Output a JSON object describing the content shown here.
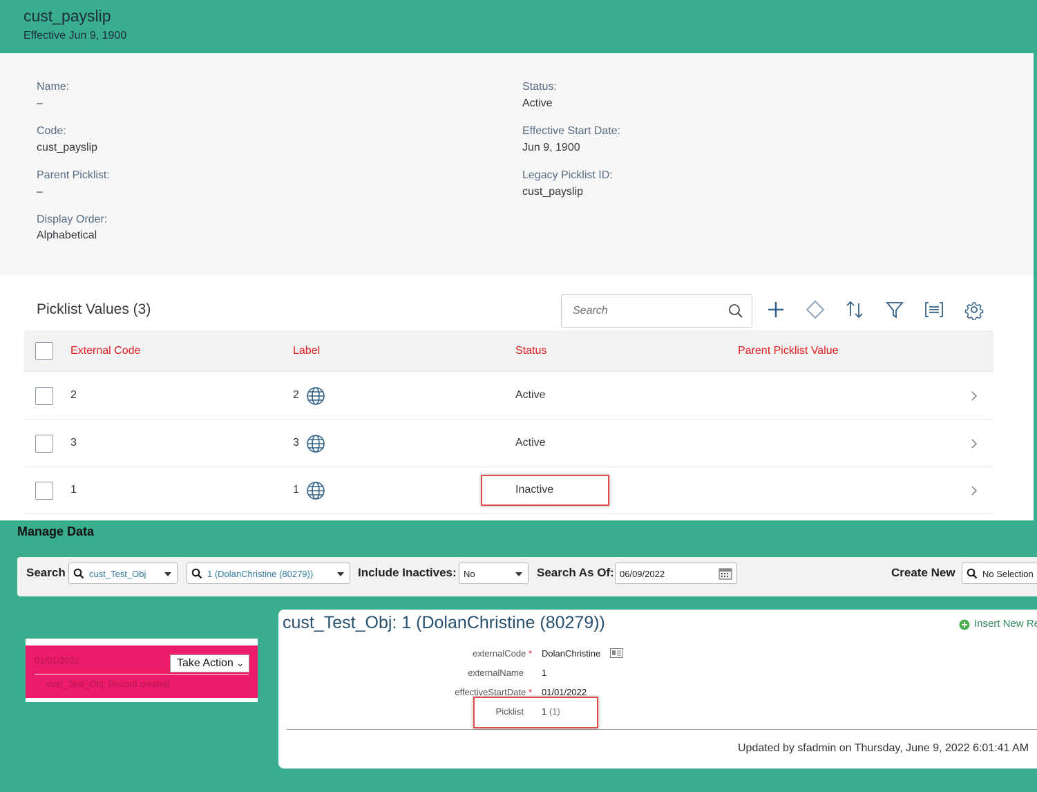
{
  "header": {
    "title": "cust_payslip",
    "subtitle": "Effective Jun 9, 1900"
  },
  "details": {
    "name_label": "Name:",
    "name_value": "–",
    "code_label": "Code:",
    "code_value": "cust_payslip",
    "parent_label": "Parent Picklist:",
    "parent_value": "–",
    "order_label": "Display Order:",
    "order_value": "Alphabetical",
    "status_label": "Status:",
    "status_value": "Active",
    "start_label": "Effective Start Date:",
    "start_value": "Jun 9, 1900",
    "legacy_label": "Legacy Picklist ID:",
    "legacy_value": "cust_payslip"
  },
  "picklist": {
    "title": "Picklist Values (3)",
    "search_placeholder": "Search",
    "columns": [
      "External Code",
      "Label",
      "Status",
      "Parent Picklist Value"
    ],
    "rows": [
      {
        "code": "2",
        "label": "2",
        "status": "Active"
      },
      {
        "code": "3",
        "label": "3",
        "status": "Active"
      },
      {
        "code": "1",
        "label": "1",
        "status": "Inactive"
      }
    ],
    "header_color": "#e02020"
  },
  "manage": {
    "title": "Manage Data",
    "search_label": "Search",
    "object_value": "cust_Test_Obj",
    "record_value": "1 (DolanChristine (80279))",
    "inactives_label": "Include Inactives:",
    "inactives_value": "No",
    "asof_label": "Search As Of:",
    "asof_value": "06/09/2022",
    "create_label": "Create New",
    "create_value": "No Selection"
  },
  "history": {
    "date": "01/01/2022",
    "action_label": "Take Action",
    "message": "cust_Test_Obj: Record created"
  },
  "record": {
    "title": "cust_Test_Obj: 1 (DolanChristine (80279))",
    "insert_label": "Insert New Re",
    "external_code_label": "externalCode",
    "external_code_value": "DolanChristine",
    "external_name_label": "externalName",
    "external_name_value": "1",
    "start_label": "effectiveStartDate",
    "start_value": "01/01/2022",
    "picklist_label": "Picklist",
    "picklist_value": "1",
    "picklist_extra": "(1)",
    "updated": "Updated by sfadmin on Thursday, June 9, 2022 6:01:41 AM"
  },
  "colors": {
    "teal": "#3aad8f",
    "history_pink": "#ec1c6a",
    "highlight_red": "#e04a4a"
  }
}
